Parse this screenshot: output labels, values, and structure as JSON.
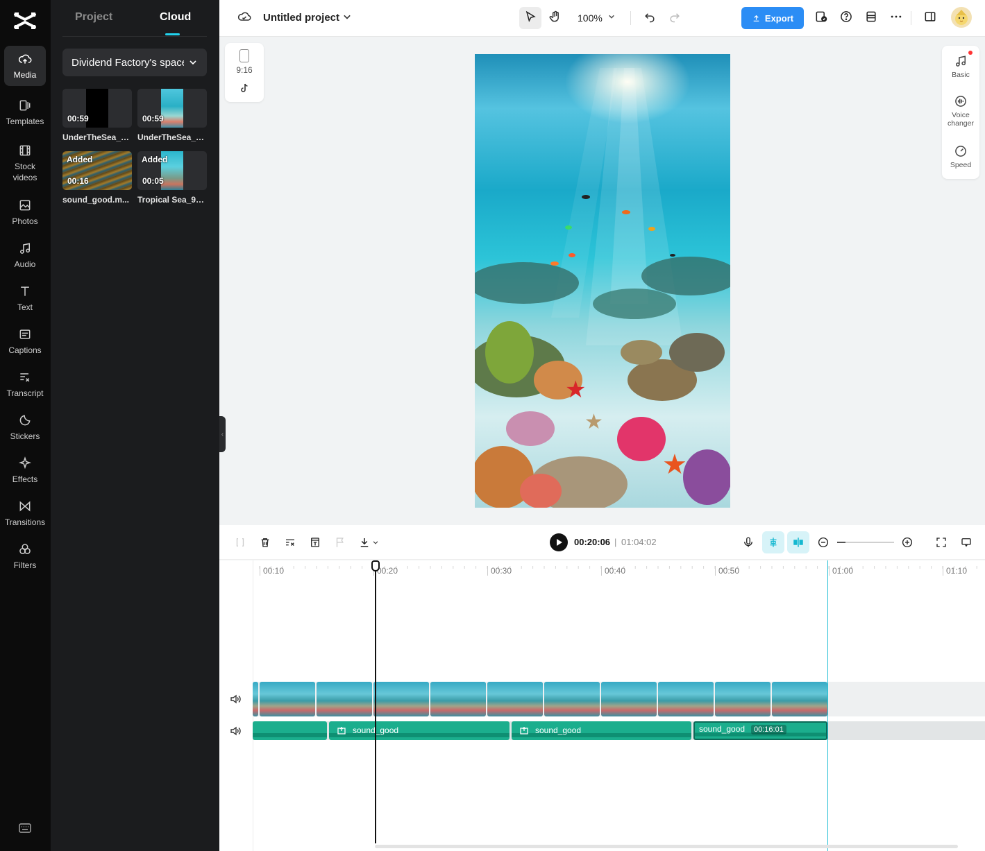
{
  "app": {
    "brand": "CapCut",
    "accent": "#2b8df5",
    "highlight": "#22d3ee"
  },
  "rail": {
    "items": [
      {
        "label": "Media",
        "icon": "cloud-upload-icon"
      },
      {
        "label": "Templates",
        "icon": "templates-icon"
      },
      {
        "label": "Stock videos",
        "icon": "film-icon"
      },
      {
        "label": "Photos",
        "icon": "photo-icon"
      },
      {
        "label": "Audio",
        "icon": "music-note-icon"
      },
      {
        "label": "Text",
        "icon": "text-icon"
      },
      {
        "label": "Captions",
        "icon": "captions-icon"
      },
      {
        "label": "Transcript",
        "icon": "transcript-icon"
      },
      {
        "label": "Stickers",
        "icon": "sticker-icon"
      },
      {
        "label": "Effects",
        "icon": "sparkle-icon"
      },
      {
        "label": "Transitions",
        "icon": "transition-icon"
      },
      {
        "label": "Filters",
        "icon": "filters-icon"
      }
    ]
  },
  "panel": {
    "tabs": [
      {
        "label": "Project"
      },
      {
        "label": "Cloud"
      }
    ],
    "space_selector": "Dividend Factory's space",
    "media": [
      {
        "name": "UnderTheSea_9...",
        "duration": "00:59",
        "badge": ""
      },
      {
        "name": "UnderTheSea_9...",
        "duration": "00:59",
        "badge": ""
      },
      {
        "name": "sound_good.m...",
        "duration": "00:16",
        "badge": "Added"
      },
      {
        "name": "Tropical Sea_91...",
        "duration": "00:05",
        "badge": "Added"
      }
    ]
  },
  "topbar": {
    "project_title": "Untitled project",
    "zoom": "100%",
    "export_label": "Export"
  },
  "canvas": {
    "ratio": "9:16",
    "right_tools": [
      {
        "label": "Basic",
        "icon": "music-note-icon"
      },
      {
        "label": "Voice changer",
        "icon": "voice-changer-icon"
      },
      {
        "label": "Speed",
        "icon": "speed-icon"
      }
    ]
  },
  "timeline": {
    "current_time": "00:20:06",
    "separator": "|",
    "total_time": "01:04:02",
    "ruler": [
      "00:10",
      "00:20",
      "00:30",
      "00:40",
      "00:50",
      "01:00",
      "01:10"
    ],
    "audio_clips": [
      {
        "label": ""
      },
      {
        "label": "sound_good"
      },
      {
        "label": "sound_good"
      },
      {
        "label": "sound_good",
        "duration": "00:16:01"
      }
    ]
  }
}
